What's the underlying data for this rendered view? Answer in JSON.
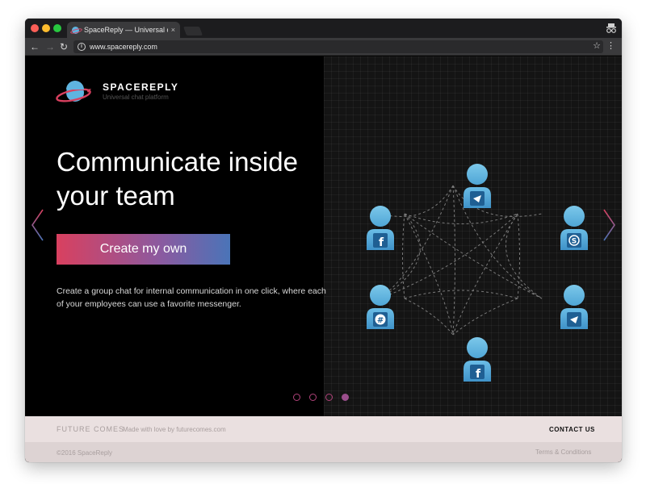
{
  "browser": {
    "tab_title": "SpaceReply — Universal chat",
    "tab_close": "×",
    "url": "www.spacereply.com",
    "back": "←",
    "forward": "→",
    "reload": "↻",
    "star": "☆",
    "menu": "⋮",
    "info": "i"
  },
  "brand": {
    "name": "SPACEREPLY",
    "tagline": "Universal chat platform"
  },
  "hero": {
    "headline_line1": "Communicate inside",
    "headline_line2": "your team",
    "cta_label": "Create my own",
    "description": "Create a group chat for internal communication in one click, where each of your employees can use a favorite messenger."
  },
  "network": {
    "users": [
      {
        "id": "top",
        "messenger": "telegram"
      },
      {
        "id": "upper-left",
        "messenger": "facebook"
      },
      {
        "id": "upper-right",
        "messenger": "skype"
      },
      {
        "id": "lower-left",
        "messenger": "slack"
      },
      {
        "id": "lower-right",
        "messenger": "telegram"
      },
      {
        "id": "bottom",
        "messenger": "facebook"
      }
    ]
  },
  "carousel": {
    "slide_count": 4,
    "active_index": 3
  },
  "footer": {
    "future_comes": "FUTURE COMES",
    "made_with": "Made with love by futurecomes.com",
    "contact": "CONTACT US",
    "copyright": "©2016 SpaceReply",
    "terms": "Terms & Conditions"
  },
  "colors": {
    "accent_pink": "#d9405f",
    "accent_blue": "#4a74b8",
    "avatar_blue": "#5fb4e0",
    "badge_blue": "#3a7cbf"
  }
}
